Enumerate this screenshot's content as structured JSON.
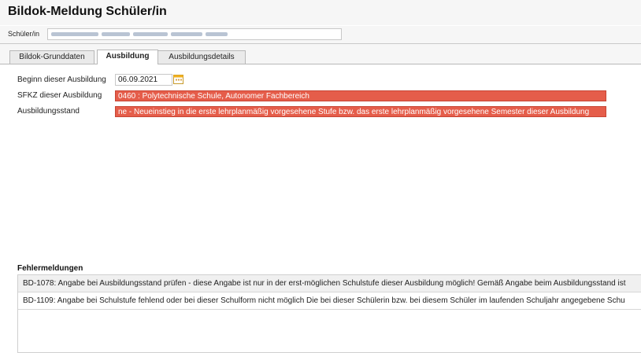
{
  "header": {
    "title": "Bildok-Meldung Schüler/in"
  },
  "student": {
    "label": "Schüler/in",
    "value_redacted": true
  },
  "tabs": [
    {
      "label": "Bildok-Grunddaten",
      "active": false
    },
    {
      "label": "Ausbildung",
      "active": true
    },
    {
      "label": "Ausbildungsdetails",
      "active": false
    }
  ],
  "form": {
    "beginn_label": "Beginn dieser Ausbildung",
    "beginn_value": "06.09.2021",
    "sfkz_label": "SFKZ dieser Ausbildung",
    "sfkz_value": "0460 : Polytechnische Schule, Autonomer Fachbereich",
    "stand_label": "Ausbildungsstand",
    "stand_value": "ne - Neueinstieg in die erste lehrplanmäßig vorgesehene Stufe bzw. das erste lehrplanmäßig vorgesehene Semester dieser Ausbildung"
  },
  "errors": {
    "heading": "Fehlermeldungen",
    "items": [
      "BD-1078: Angabe bei Ausbildungsstand prüfen - diese Angabe ist nur in der erst-möglichen Schulstufe dieser Ausbildung möglich! Gemäß Angabe beim Ausbildungsstand ist",
      "BD-1109: Angabe bei Schulstufe fehlend oder bei dieser Schulform nicht möglich Die bei dieser Schülerin bzw. bei diesem Schüler im laufenden Schuljahr angegebene Schu"
    ]
  },
  "colors": {
    "error_field": "#e55d4a",
    "calendar_icon": "#f2b01e"
  },
  "icons": {
    "date_picker": "calendar-icon"
  }
}
